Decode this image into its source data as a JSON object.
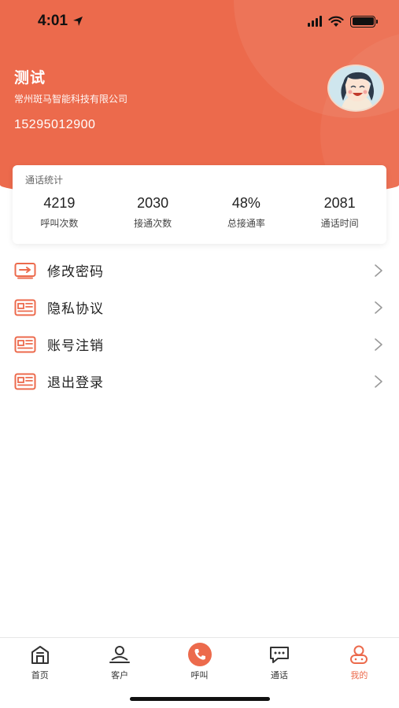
{
  "status_bar": {
    "time": "4:01"
  },
  "profile": {
    "name": "测试",
    "company": "常州斑马智能科技有限公司",
    "phone": "15295012900"
  },
  "stats": {
    "title": "通话统计",
    "items": [
      {
        "value": "4219",
        "label": "呼叫次数"
      },
      {
        "value": "2030",
        "label": "接通次数"
      },
      {
        "value": "48%",
        "label": "总接通率"
      },
      {
        "value": "2081",
        "label": "通话时间"
      }
    ]
  },
  "menu": [
    {
      "label": "修改密码",
      "icon": "password-icon"
    },
    {
      "label": "隐私协议",
      "icon": "document-icon"
    },
    {
      "label": "账号注销",
      "icon": "document-icon"
    },
    {
      "label": "退出登录",
      "icon": "document-icon"
    }
  ],
  "tabbar": {
    "items": [
      {
        "label": "首页",
        "icon": "home-icon"
      },
      {
        "label": "客户",
        "icon": "customer-icon"
      },
      {
        "label": "呼叫",
        "icon": "phone-icon"
      },
      {
        "label": "通话",
        "icon": "chat-icon"
      },
      {
        "label": "我的",
        "icon": "profile-icon"
      }
    ],
    "active_index": 4
  },
  "colors": {
    "accent": "#ec6a4c"
  }
}
